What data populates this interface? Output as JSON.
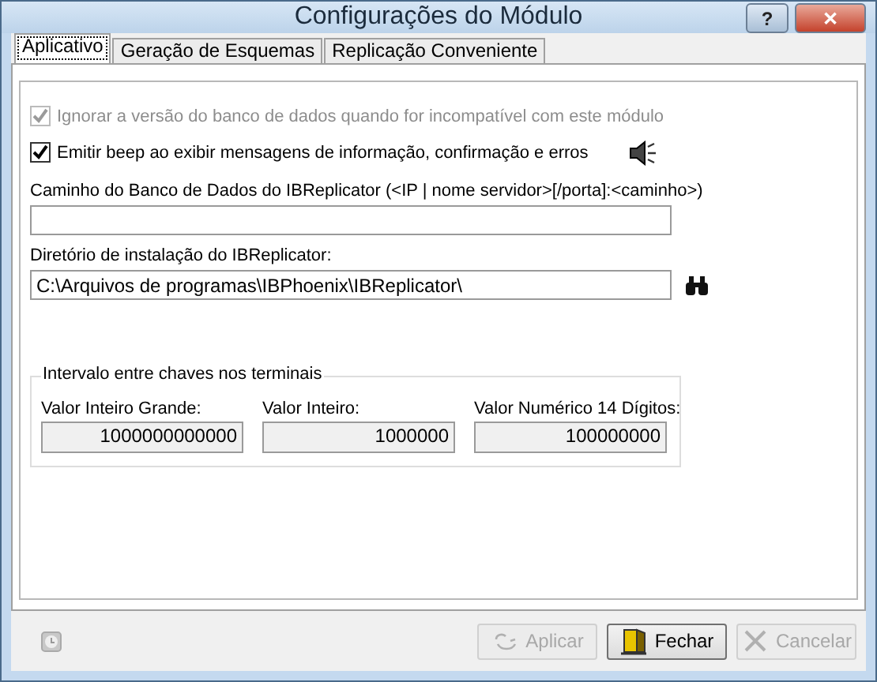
{
  "window": {
    "title": "Configurações do Módulo",
    "help_button": "?",
    "close_button": "✕"
  },
  "tabs": [
    {
      "label": "Aplicativo",
      "selected": true
    },
    {
      "label": "Geração de Esquemas",
      "selected": false
    },
    {
      "label": "Replicação Conveniente",
      "selected": false
    }
  ],
  "options": [
    {
      "label": "Ignorar a versão do banco de dados quando for incompatível com este módulo",
      "checked": true,
      "disabled": true,
      "sound_icon": false
    },
    {
      "label": "Emitir beep ao exibir mensagens de informação, confirmação e erros",
      "checked": true,
      "disabled": false,
      "sound_icon": true
    }
  ],
  "fields": [
    {
      "label": "Caminho do Banco de Dados do IBReplicator (<IP | nome servidor>[/porta]:<caminho>)",
      "browse": false
    },
    {
      "label": "Diretório de instalação do IBReplicator:",
      "value": "C:\\Arquivos de programas\\IBPhoenix\\IBReplicator\\",
      "browse": true
    }
  ],
  "interval_group": {
    "title": "Intervalo entre chaves nos terminais",
    "fields": [
      {
        "label": "Valor Inteiro Grande:",
        "value": "1000000000000"
      },
      {
        "label": "Valor Inteiro:",
        "value": "1000000"
      },
      {
        "label": "Valor Numérico 14 Dígitos:",
        "value": "100000000"
      }
    ]
  },
  "buttons": [
    {
      "label": "Aplicar",
      "kind": "apply",
      "disabled": true
    },
    {
      "label": "Fechar",
      "kind": "close",
      "disabled": false
    },
    {
      "label": "Cancelar",
      "kind": "cancel",
      "disabled": true
    }
  ]
}
